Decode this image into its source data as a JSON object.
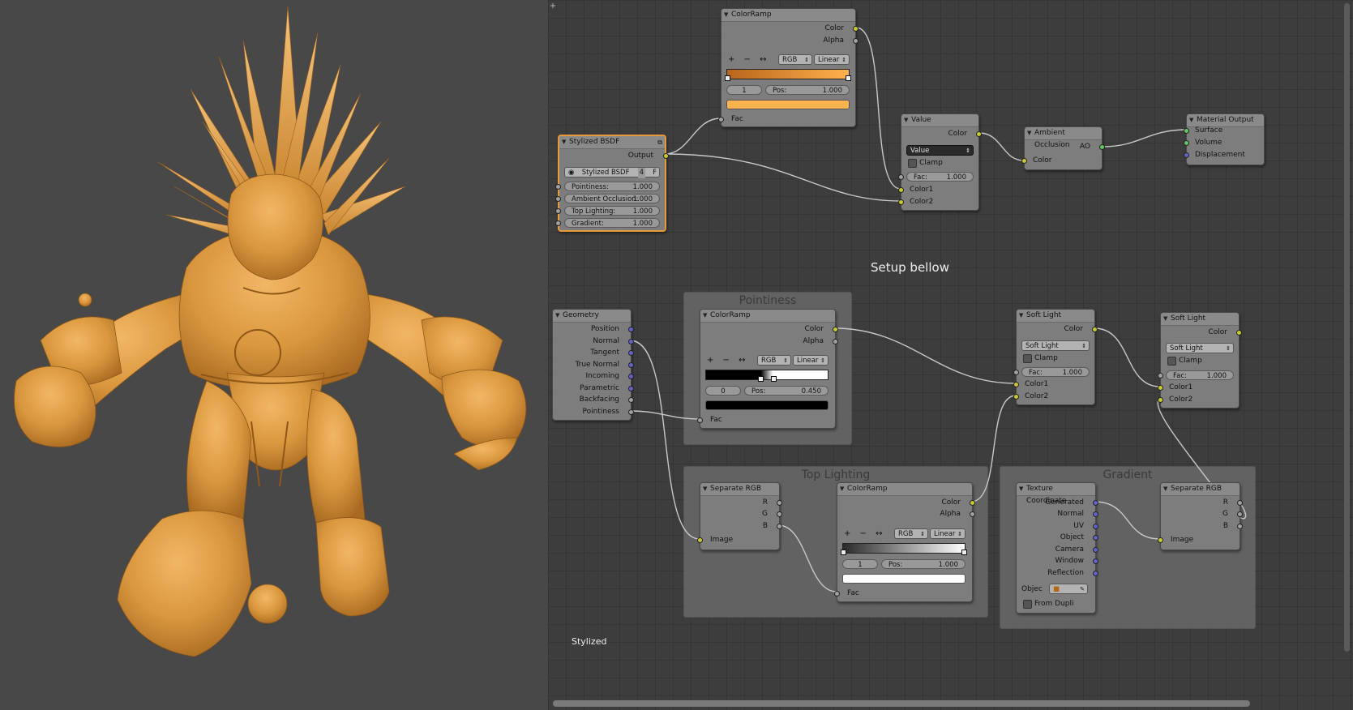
{
  "viewport": {
    "model": "stylized troll character render",
    "material_color": "#d9973e",
    "background": "#484848"
  },
  "editor": {
    "plus_a": "+",
    "plus_b": "+",
    "note": "Setup bellow",
    "corner_label": "Stylized",
    "frames": {
      "pointiness": "Pointiness",
      "top_lighting": "Top Lighting",
      "gradient": "Gradient"
    },
    "nodes": {
      "colorramp_top": {
        "title": "ColorRamp",
        "out_color": "Color",
        "out_alpha": "Alpha",
        "tools": "+ − ↔",
        "mode": "RGB",
        "interp": "Linear",
        "index": "1",
        "pos_label": "Pos:",
        "pos_value": "1.000",
        "in_fac": "Fac",
        "swatch_color": "#ffb24d"
      },
      "stylized_bsdf": {
        "title": "Stylized BSDF",
        "out": "Output",
        "group_name": "Stylized BSDF",
        "users": "4",
        "fake": "F",
        "inputs": [
          {
            "label": "Pointiness:",
            "value": "1.000"
          },
          {
            "label": "Ambient Occlusion:",
            "value": "1.000"
          },
          {
            "label": "Top Lighting:",
            "value": "1.000"
          },
          {
            "label": "Gradient:",
            "value": "1.000"
          }
        ]
      },
      "value_mix": {
        "title": "Value",
        "out_color": "Color",
        "blend": "Value",
        "clamp": "Clamp",
        "fac_label": "Fac:",
        "fac_value": "1.000",
        "in1": "Color1",
        "in2": "Color2"
      },
      "ambient_occlusion": {
        "title": "Ambient Occlusion",
        "out_ao": "AO",
        "in_color": "Color"
      },
      "material_output": {
        "title": "Material Output",
        "in_surface": "Surface",
        "in_volume": "Volume",
        "in_displacement": "Displacement"
      },
      "geometry": {
        "title": "Geometry",
        "outputs": [
          "Position",
          "Normal",
          "Tangent",
          "True Normal",
          "Incoming",
          "Parametric",
          "Backfacing",
          "Pointiness"
        ]
      },
      "colorramp_pointiness": {
        "title": "ColorRamp",
        "out_color": "Color",
        "out_alpha": "Alpha",
        "tools": "+ − ↔",
        "mode": "RGB",
        "interp": "Linear",
        "index": "0",
        "pos_label": "Pos:",
        "pos_value": "0.450",
        "in_fac": "Fac",
        "swatch_color": "#000000"
      },
      "soft_light_1": {
        "title": "Soft Light",
        "out_color": "Color",
        "blend": "Soft Light",
        "clamp": "Clamp",
        "fac_label": "Fac:",
        "fac_value": "1.000",
        "in1": "Color1",
        "in2": "Color2"
      },
      "soft_light_2": {
        "title": "Soft Light",
        "out_color": "Color",
        "blend": "Soft Light",
        "clamp": "Clamp",
        "fac_label": "Fac:",
        "fac_value": "1.000",
        "in1": "Color1",
        "in2": "Color2"
      },
      "separate_rgb_1": {
        "title": "Separate RGB",
        "out_r": "R",
        "out_g": "G",
        "out_b": "B",
        "in_image": "Image"
      },
      "colorramp_top_lighting": {
        "title": "ColorRamp",
        "out_color": "Color",
        "out_alpha": "Alpha",
        "tools": "+ − ↔",
        "mode": "RGB",
        "interp": "Linear",
        "index": "1",
        "pos_label": "Pos:",
        "pos_value": "1.000",
        "in_fac": "Fac",
        "swatch_color": "#ffffff"
      },
      "texture_coordinate": {
        "title": "Texture Coordinate",
        "outputs": [
          "Generated",
          "Normal",
          "UV",
          "Object",
          "Camera",
          "Window",
          "Reflection"
        ],
        "object_label": "Objec",
        "from_dupli": "From Dupli"
      },
      "separate_rgb_2": {
        "title": "Separate RGB",
        "out_r": "R",
        "out_g": "G",
        "out_b": "B",
        "in_image": "Image"
      }
    }
  }
}
